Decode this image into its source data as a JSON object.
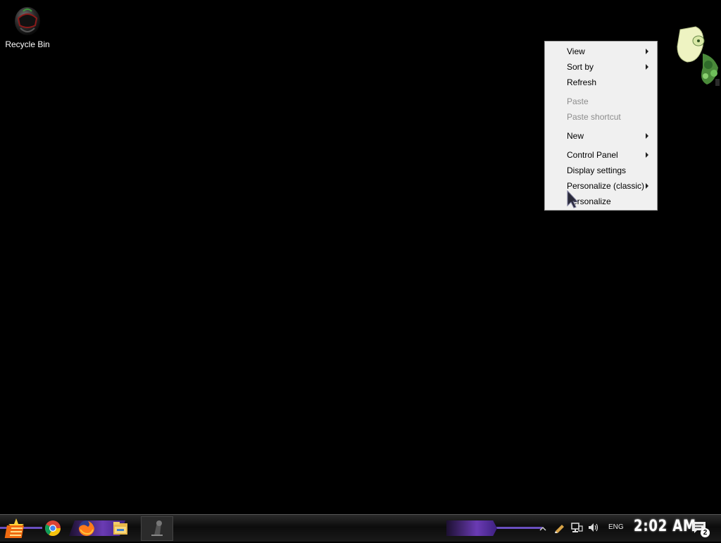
{
  "desktop": {
    "icons": [
      {
        "label": "Recycle Bin",
        "icon": "recycle-bin-icon"
      }
    ]
  },
  "context_menu": {
    "items": [
      {
        "label": "View",
        "submenu": true,
        "disabled": false
      },
      {
        "label": "Sort by",
        "submenu": true,
        "disabled": false
      },
      {
        "label": "Refresh",
        "submenu": false,
        "disabled": false
      },
      {
        "label": "Paste",
        "submenu": false,
        "disabled": true
      },
      {
        "label": "Paste shortcut",
        "submenu": false,
        "disabled": true
      },
      {
        "label": "New",
        "submenu": true,
        "disabled": false
      },
      {
        "label": "Control Panel",
        "submenu": true,
        "disabled": false
      },
      {
        "label": "Display settings",
        "submenu": false,
        "disabled": false
      },
      {
        "label": "Personalize (classic)",
        "submenu": true,
        "disabled": false
      },
      {
        "label": "Personalize",
        "submenu": false,
        "disabled": false
      }
    ]
  },
  "taskbar": {
    "pinned": [
      {
        "icon": "start-orb-icon"
      },
      {
        "icon": "chrome-icon"
      },
      {
        "icon": "firefox-icon"
      },
      {
        "icon": "file-explorer-icon"
      },
      {
        "icon": "app-icon"
      }
    ],
    "tray": {
      "language": "ENG",
      "time": "2:02 AM",
      "notification_count": "2",
      "icons": [
        "show-hidden-icons-chevron",
        "pen-icon",
        "network-icon",
        "volume-icon"
      ]
    }
  },
  "colors": {
    "desktop_bg": "#000000",
    "menu_bg": "#f0f0f0",
    "menu_disabled_text": "#8d8d8d",
    "taskbar_accent": "#6a3bb3"
  }
}
